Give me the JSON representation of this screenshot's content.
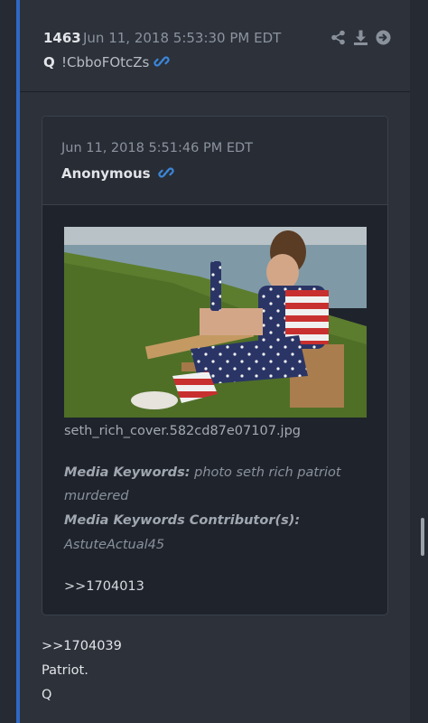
{
  "post": {
    "id": "1463",
    "date": "Jun 11, 2018 5:53:30 PM EDT",
    "author": "Q",
    "tripcode": "!CbboFOtcZs",
    "icons": [
      "share-icon",
      "download-icon",
      "goto-icon",
      "link-icon"
    ],
    "body_lines": [
      ">>1704039",
      "Patriot.",
      "Q"
    ]
  },
  "quoted": {
    "date": "Jun 11, 2018 5:51:46 PM EDT",
    "author": "Anonymous",
    "image_filename": "seth_rich_cover.582cd87e07107.jpg",
    "keywords_label": "Media Keywords:",
    "keywords_value": "photo seth rich patriot murdered",
    "contributor_label": "Media Keywords Contributor(s):",
    "contributor_value": "AstuteActual45",
    "reference": ">>1704013"
  },
  "colors": {
    "accent": "#2f67c5",
    "link": "#3b86d8"
  }
}
